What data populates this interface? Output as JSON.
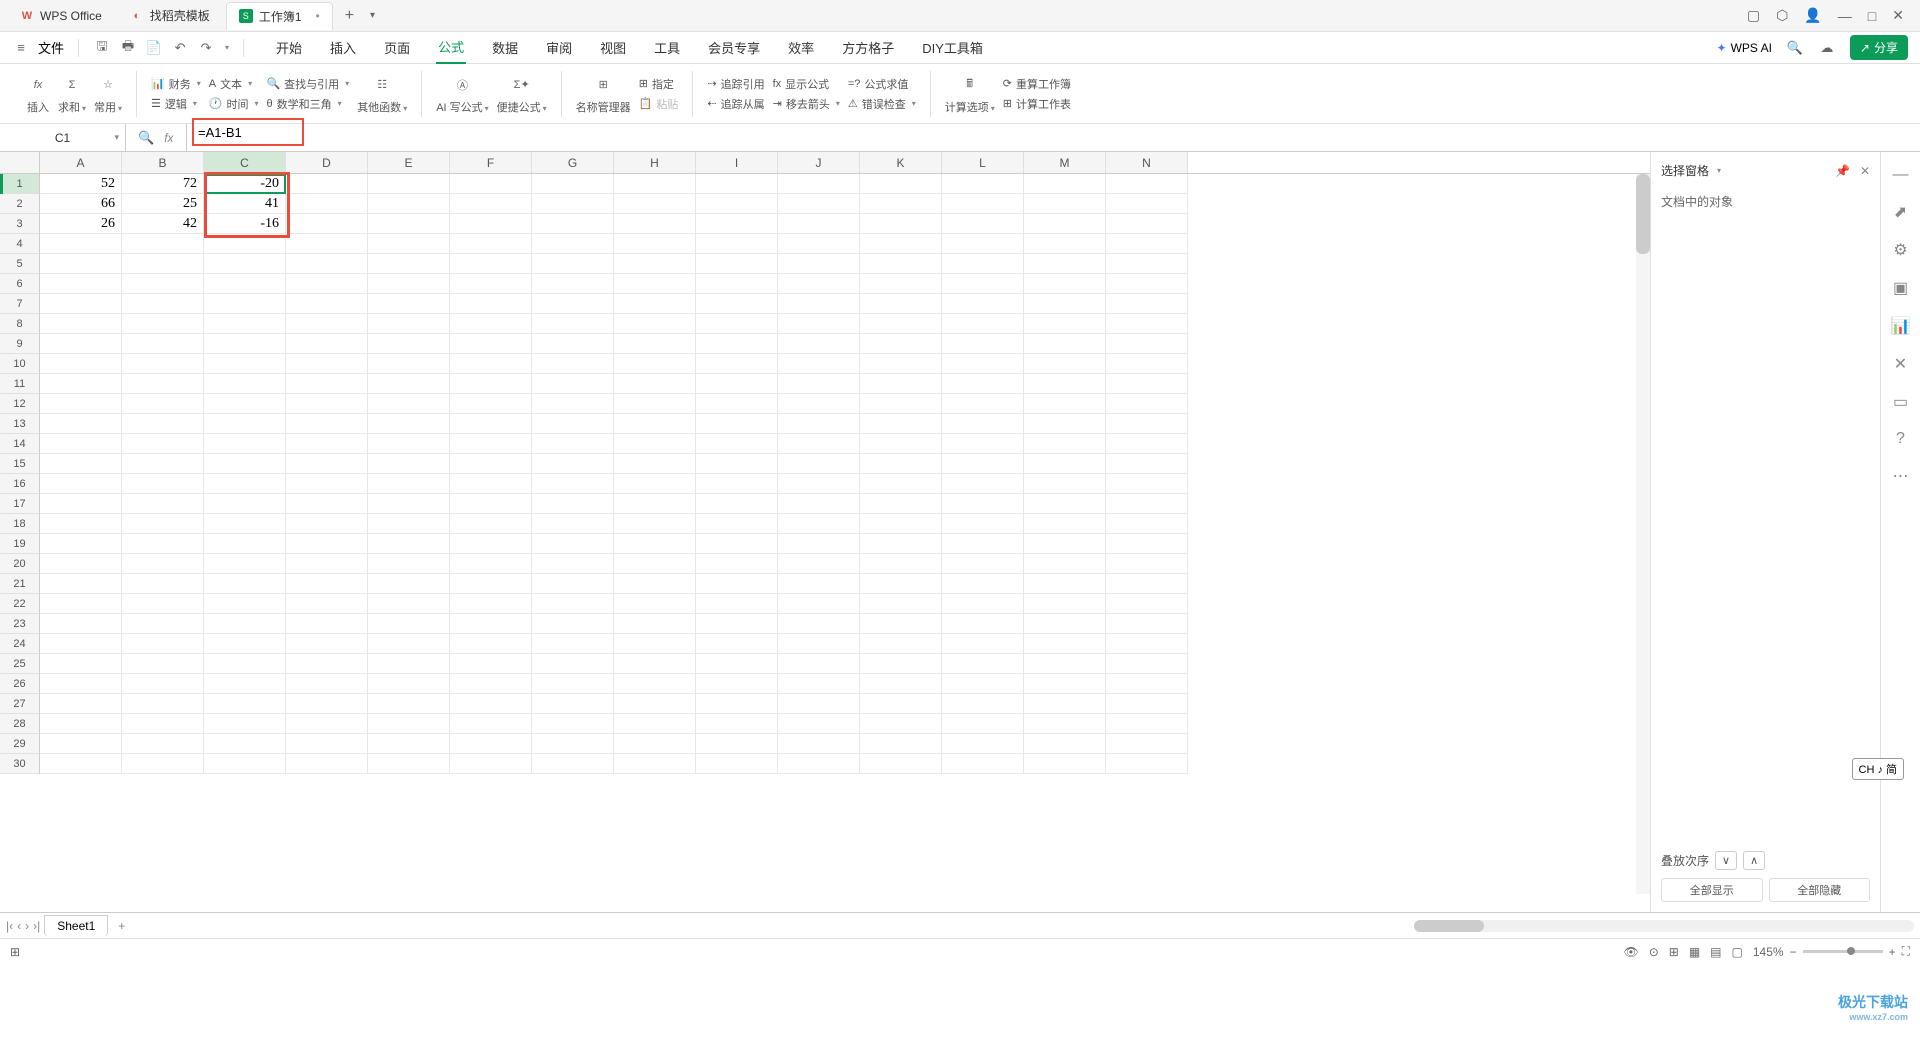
{
  "tabs": {
    "wps_office": "WPS Office",
    "templates": "找稻壳模板",
    "workbook": "工作簿1"
  },
  "menu": {
    "file": "文件",
    "items": [
      "开始",
      "插入",
      "页面",
      "公式",
      "数据",
      "审阅",
      "视图",
      "工具",
      "会员专享",
      "效率",
      "方方格子",
      "DIY工具箱"
    ],
    "wps_ai": "WPS AI",
    "share": "分享"
  },
  "ribbon": {
    "insert": "插入",
    "sum": "求和",
    "common": "常用",
    "finance": "财务",
    "text": "文本",
    "lookup": "查找与引用",
    "logic": "逻辑",
    "time": "时间",
    "math": "数学和三角",
    "other": "其他函数",
    "ai_write": "AI 写公式",
    "quick": "便捷公式",
    "name_mgr": "名称管理器",
    "assign": "指定",
    "paste": "粘贴",
    "trace_ref": "追踪引用",
    "trace_dep": "追踪从属",
    "show_formula": "显示公式",
    "remove_arrow": "移去箭头",
    "eval": "公式求值",
    "error_check": "错误检查",
    "calc_opt": "计算选项",
    "recalc": "重算工作簿",
    "calc_sheet": "计算工作表"
  },
  "formula_bar": {
    "cell_ref": "C1",
    "formula": "=A1-B1"
  },
  "columns": [
    "A",
    "B",
    "C",
    "D",
    "E",
    "F",
    "G",
    "H",
    "I",
    "J",
    "K",
    "L",
    "M",
    "N"
  ],
  "rows_count": 30,
  "data": {
    "A1": "52",
    "B1": "72",
    "C1": "-20",
    "A2": "66",
    "B2": "25",
    "C2": "41",
    "A3": "26",
    "B3": "42",
    "C3": "-16"
  },
  "side": {
    "title": "选择窗格",
    "subtitle": "文档中的对象",
    "stack_order": "叠放次序",
    "show_all": "全部显示",
    "hide_all": "全部隐藏"
  },
  "sheet": {
    "name": "Sheet1"
  },
  "status": {
    "zoom": "145%",
    "ime": "CH ♪ 简"
  },
  "watermark": {
    "name": "极光下载站",
    "url": "www.xz7.com"
  }
}
